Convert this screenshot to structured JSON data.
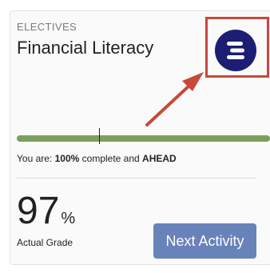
{
  "card": {
    "category": "ELECTIVES",
    "title": "Financial Literacy",
    "icon": "course-logo-icon",
    "progress": {
      "percent": 100,
      "prefix": "You are: ",
      "percent_text": "100%",
      "middle": " complete and ",
      "status": "AHEAD"
    },
    "grade": {
      "value": "97",
      "unit": "%",
      "label": "Actual Grade"
    },
    "next_button_label": "Next Activity"
  },
  "annotation": {
    "highlight_color": "#c8493a",
    "arrow_icon": "arrow-icon"
  },
  "colors": {
    "icon_bg": "#1b1e72",
    "progress": "#7ba05b",
    "button": "#6882ba"
  }
}
